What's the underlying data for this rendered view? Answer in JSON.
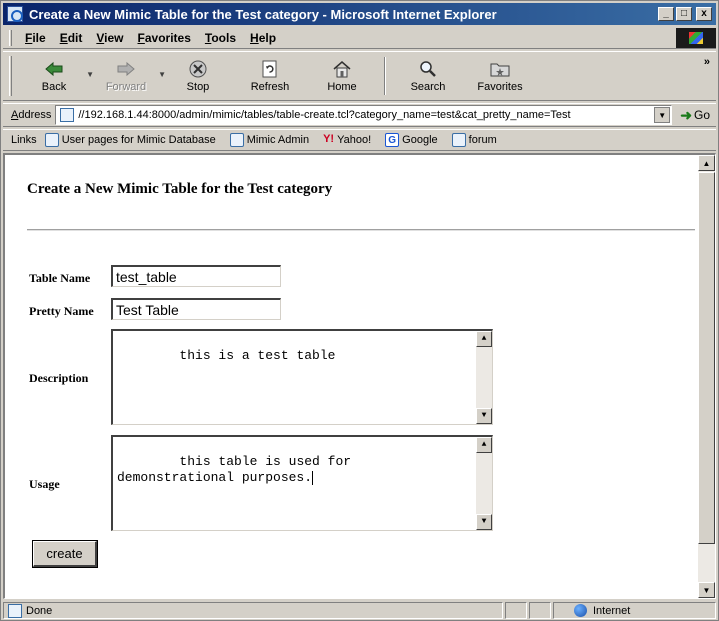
{
  "window": {
    "title": "Create a New Mimic Table for the Test category - Microsoft Internet Explorer",
    "minimize_glyph": "_",
    "maximize_glyph": "□",
    "close_glyph": "x"
  },
  "menu": [
    "File",
    "Edit",
    "View",
    "Favorites",
    "Tools",
    "Help"
  ],
  "toolbar": {
    "back": "Back",
    "forward": "Forward",
    "stop": "Stop",
    "refresh": "Refresh",
    "home": "Home",
    "search": "Search",
    "favorites": "Favorites",
    "more": "»"
  },
  "address": {
    "label": "Address",
    "url": "//192.168.1.44:8000/admin/mimic/tables/table-create.tcl?category_name=test&cat_pretty_name=Test",
    "go": "Go"
  },
  "links": {
    "label": "Links",
    "items": [
      "User pages for Mimic Database",
      "Mimic Admin",
      "Yahoo!",
      "Google",
      "forum"
    ]
  },
  "page": {
    "title": "Create a New Mimic Table for the Test category",
    "form": {
      "table_name_label": "Table Name",
      "table_name_value": "test_table",
      "pretty_name_label": "Pretty Name",
      "pretty_name_value": "Test Table",
      "description_label": "Description",
      "description_value": "this is a test table",
      "usage_label": "Usage",
      "usage_value": "this table is used for demonstrational purposes.",
      "submit_label": "create"
    }
  },
  "status": {
    "text": "Done",
    "zone": "Internet"
  },
  "colors": {
    "titlebar_start": "#0a246a",
    "titlebar_end": "#3a6ea5",
    "chrome": "#d4d0c8"
  }
}
